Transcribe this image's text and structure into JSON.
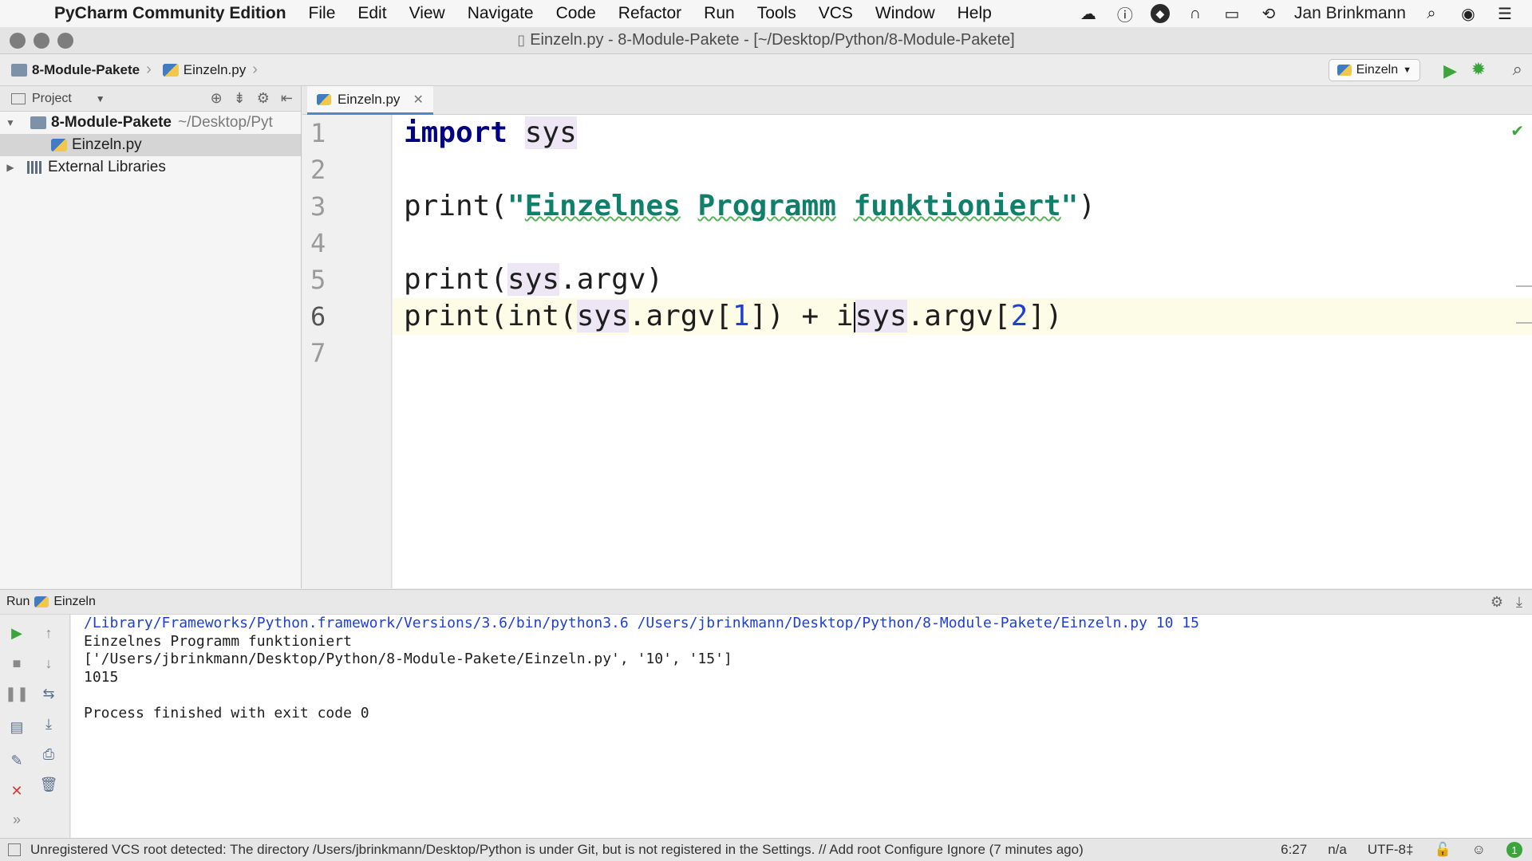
{
  "menubar": {
    "app_name": "PyCharm Community Edition",
    "items": [
      "File",
      "Edit",
      "View",
      "Navigate",
      "Code",
      "Refactor",
      "Run",
      "Tools",
      "VCS",
      "Window",
      "Help"
    ],
    "user": "Jan Brinkmann"
  },
  "window": {
    "title": "Einzeln.py - 8-Module-Pakete - [~/Desktop/Python/8-Module-Pakete]"
  },
  "navbar": {
    "crumbs": [
      "8-Module-Pakete",
      "Einzeln.py"
    ],
    "run_config": "Einzeln"
  },
  "project": {
    "header_label": "Project",
    "root_name": "8-Module-Pakete",
    "root_path": "~/Desktop/Pyt",
    "file": "Einzeln.py",
    "external": "External Libraries"
  },
  "editor": {
    "tab_label": "Einzeln.py",
    "line_numbers": [
      "1",
      "2",
      "3",
      "4",
      "5",
      "6",
      "7"
    ],
    "caret_line": 6,
    "code": {
      "l1_kw": "import",
      "l1_mod": "sys",
      "l3_fn": "print(",
      "l3_q1": "\"",
      "l3_w1": "Einzelnes",
      "l3_w2": "Programm",
      "l3_w3": "funktioniert",
      "l3_q2": "\"",
      "l3_end": ")",
      "l5_fn": "print(",
      "l5_sys": "sys",
      "l5_rest": ".argv)",
      "l6_a": "print(int(",
      "l6_sys1": "sys",
      "l6_b": ".argv[",
      "l6_n1": "1",
      "l6_c": "]) + i",
      "l6_sys2": "sys",
      "l6_d": ".argv[",
      "l6_n2": "2",
      "l6_e": "])"
    }
  },
  "run_panel": {
    "label": "Run",
    "config": "Einzeln",
    "output": [
      "/Library/Frameworks/Python.framework/Versions/3.6/bin/python3.6 /Users/jbrinkmann/Desktop/Python/8-Module-Pakete/Einzeln.py 10 15",
      "Einzelnes Programm funktioniert",
      "['/Users/jbrinkmann/Desktop/Python/8-Module-Pakete/Einzeln.py', '10', '15']",
      "1015",
      "",
      "Process finished with exit code 0"
    ]
  },
  "statusbar": {
    "message": "Unregistered VCS root detected: The directory /Users/jbrinkmann/Desktop/Python is under Git, but is not registered in the Settings. // Add root  Configure  Ignore (7 minutes ago)",
    "position": "6:27",
    "na": "n/a",
    "encoding": "UTF-8‡",
    "notifications": "1"
  }
}
